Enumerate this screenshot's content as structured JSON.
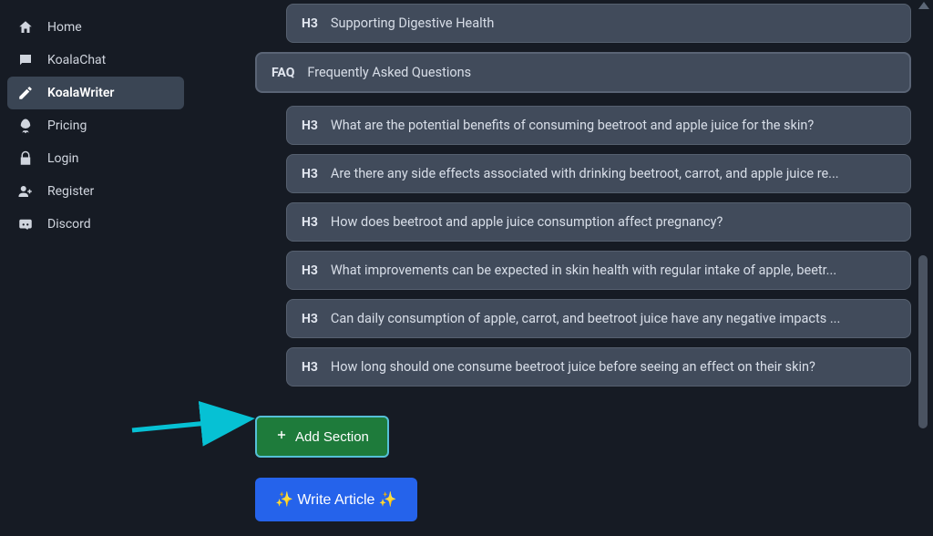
{
  "sidebar": {
    "items": [
      {
        "label": "Home"
      },
      {
        "label": "KoalaChat"
      },
      {
        "label": "KoalaWriter"
      },
      {
        "label": "Pricing"
      },
      {
        "label": "Login"
      },
      {
        "label": "Register"
      },
      {
        "label": "Discord"
      }
    ]
  },
  "outline": {
    "top_h3": {
      "tag": "H3",
      "text": "Supporting Digestive Health"
    },
    "faq": {
      "tag": "FAQ",
      "text": "Frequently Asked Questions"
    },
    "questions": [
      {
        "tag": "H3",
        "text": "What are the potential benefits of consuming beetroot and apple juice for the skin?"
      },
      {
        "tag": "H3",
        "text": "Are there any side effects associated with drinking beetroot, carrot, and apple juice re..."
      },
      {
        "tag": "H3",
        "text": "How does beetroot and apple juice consumption affect pregnancy?"
      },
      {
        "tag": "H3",
        "text": "What improvements can be expected in skin health with regular intake of apple, beetr..."
      },
      {
        "tag": "H3",
        "text": "Can daily consumption of apple, carrot, and beetroot juice have any negative impacts ..."
      },
      {
        "tag": "H3",
        "text": "How long should one consume beetroot juice before seeing an effect on their skin?"
      }
    ]
  },
  "buttons": {
    "add_section": "Add Section",
    "write_article": "✨ Write Article ✨"
  }
}
